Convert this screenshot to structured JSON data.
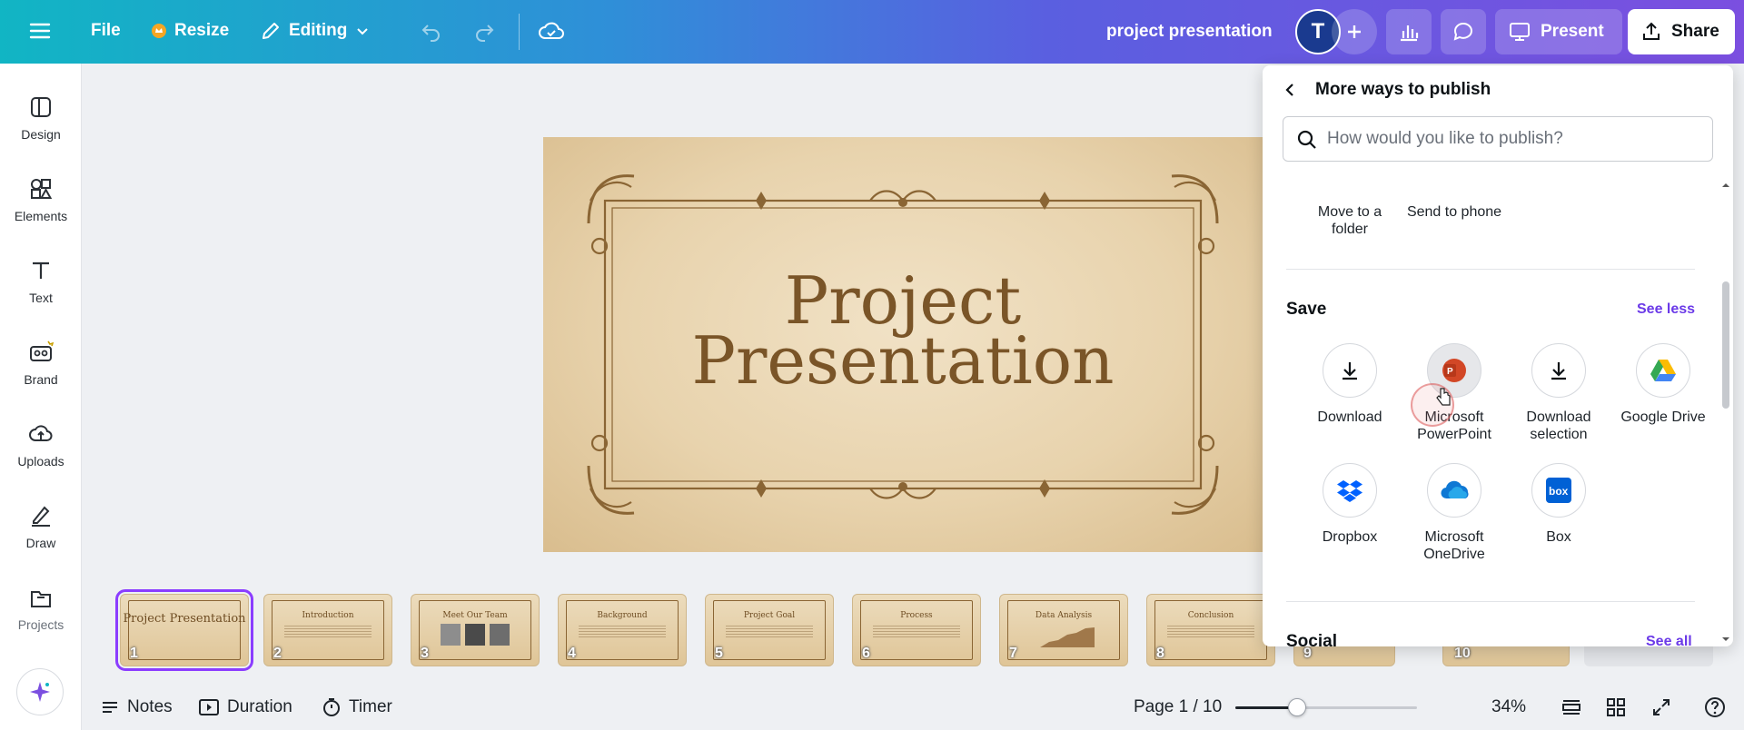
{
  "topbar": {
    "file_label": "File",
    "resize_label": "Resize",
    "editing_label": "Editing",
    "doc_title": "project presentation",
    "avatar_initial": "T",
    "present_label": "Present",
    "share_label": "Share"
  },
  "rail": {
    "items": [
      {
        "label": "Design",
        "icon": "design-icon"
      },
      {
        "label": "Elements",
        "icon": "elements-icon"
      },
      {
        "label": "Text",
        "icon": "text-icon"
      },
      {
        "label": "Brand",
        "icon": "brand-icon"
      },
      {
        "label": "Uploads",
        "icon": "uploads-icon"
      },
      {
        "label": "Draw",
        "icon": "draw-icon"
      },
      {
        "label": "Projects",
        "icon": "projects-icon"
      }
    ]
  },
  "slide": {
    "title_line1": "Project",
    "title_line2": "Presentation",
    "text_color": "#7a5528"
  },
  "thumbnails": [
    {
      "num": "1",
      "title": "Project Presentation"
    },
    {
      "num": "2",
      "title": "Introduction"
    },
    {
      "num": "3",
      "title": "Meet Our Team"
    },
    {
      "num": "4",
      "title": "Background"
    },
    {
      "num": "5",
      "title": "Project Goal"
    },
    {
      "num": "6",
      "title": "Process"
    },
    {
      "num": "7",
      "title": "Data Analysis"
    },
    {
      "num": "8",
      "title": "Conclusion"
    },
    {
      "num": "9",
      "title": ""
    },
    {
      "num": "10",
      "title": ""
    }
  ],
  "bottombar": {
    "notes_label": "Notes",
    "duration_label": "Duration",
    "timer_label": "Timer",
    "page_label": "Page 1 / 10",
    "zoom_label": "34%",
    "zoom_level": 0.34
  },
  "panel": {
    "title": "More ways to publish",
    "search_placeholder": "How would you like to publish?",
    "top_options": [
      {
        "label": "Move to a folder"
      },
      {
        "label": "Send to phone"
      }
    ],
    "save_title": "Save",
    "see_less_label": "See less",
    "save_options": [
      {
        "label": "Download",
        "icon": "download-icon"
      },
      {
        "label": "Microsoft PowerPoint",
        "icon": "powerpoint-icon"
      },
      {
        "label": "Download selection",
        "icon": "download-selection-icon"
      },
      {
        "label": "Google Drive",
        "icon": "google-drive-icon"
      },
      {
        "label": "Dropbox",
        "icon": "dropbox-icon"
      },
      {
        "label": "Microsoft OneDrive",
        "icon": "onedrive-icon"
      },
      {
        "label": "Box",
        "icon": "box-icon"
      }
    ],
    "social_title": "Social",
    "see_all_label": "See all"
  },
  "colors": {
    "accent": "#8b3dff",
    "link": "#6b3ae8"
  }
}
